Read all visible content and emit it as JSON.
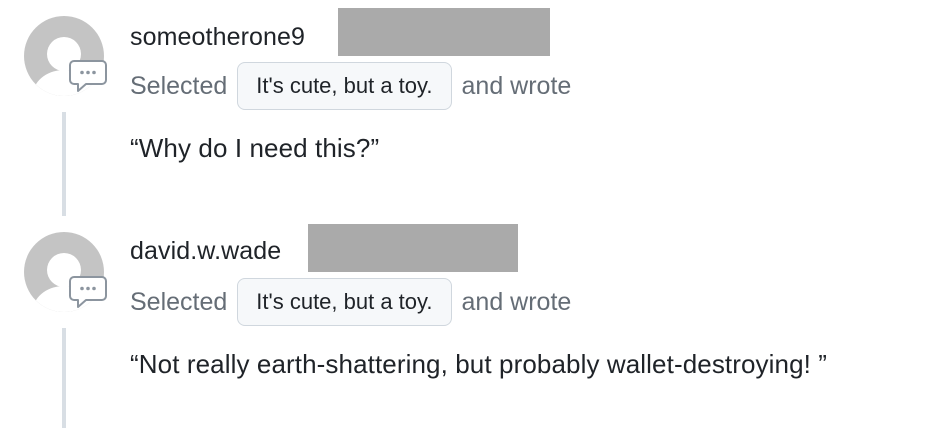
{
  "entries": [
    {
      "username": "someotherone9",
      "action_prefix": "Selected",
      "selected_option": "It's cute, but a toy.",
      "action_suffix": "and wrote",
      "comment": "“Why do I need this?”"
    },
    {
      "username": "david.w.wade",
      "action_prefix": "Selected",
      "selected_option": "It's cute, but a toy.",
      "action_suffix": "and wrote",
      "comment": "“Not really earth-shattering, but probably wallet-destroying! ”"
    }
  ],
  "icons": {
    "avatar": "default-avatar-icon",
    "comment": "comment-bubble-icon"
  },
  "colors": {
    "avatar_gray": "#c4c4c4",
    "redaction_gray": "#aaaaaa",
    "muted_text": "#656d76",
    "pill_background": "#f6f8fa",
    "thread_line": "#d8dee4"
  }
}
